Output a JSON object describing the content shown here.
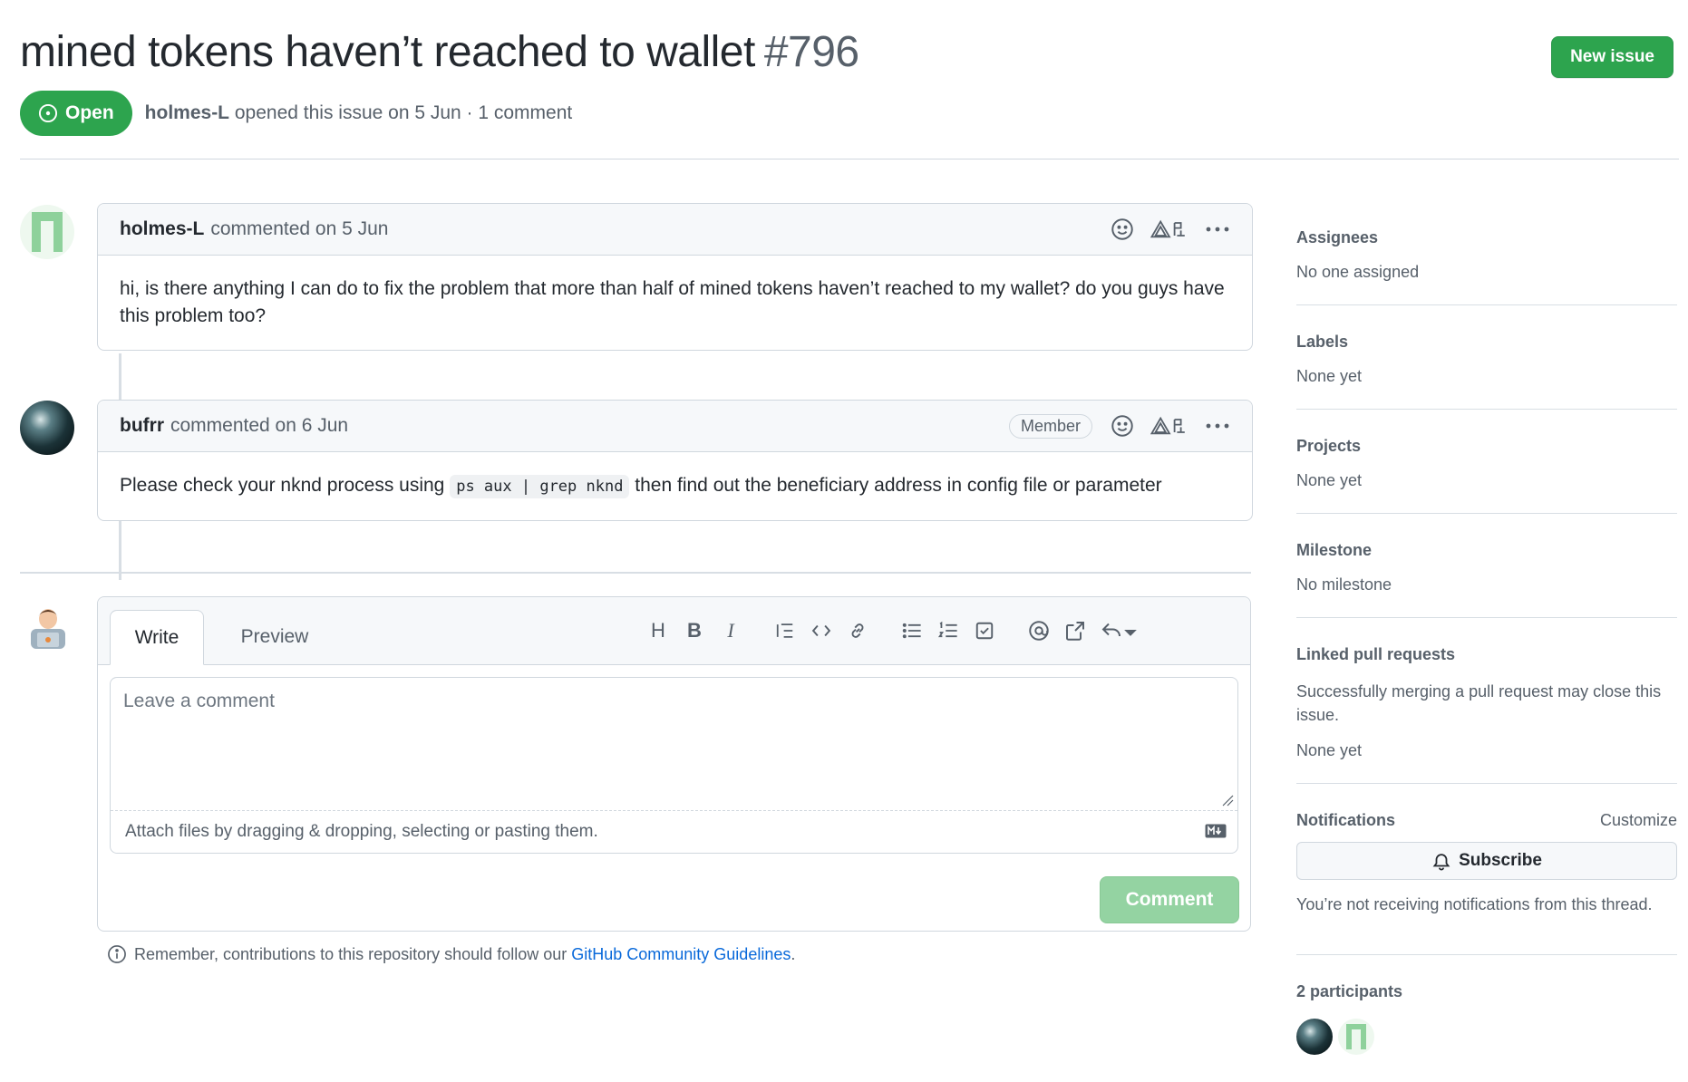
{
  "issue": {
    "title": "mined tokens haven’t reached to wallet",
    "number": "#796",
    "state": "Open",
    "author": "holmes-L",
    "opened_text": "opened this issue on 5 Jun · 1 comment"
  },
  "header": {
    "new_issue_label": "New issue"
  },
  "comments": [
    {
      "author": "holmes-L",
      "meta": "commented on 5 Jun",
      "body": "hi, is there anything I can do to fix the problem that more than half of mined tokens haven’t reached to my wallet? do you guys have this problem too?"
    },
    {
      "author": "bufrr",
      "meta": "commented on 6 Jun",
      "role_badge": "Member",
      "body_before": "Please check your nknd process using",
      "body_code": "ps aux | grep nknd",
      "body_after": "then find out the beneficiary address in config file or parameter"
    }
  ],
  "composer": {
    "tab_write": "Write",
    "tab_preview": "Preview",
    "placeholder": "Leave a comment",
    "attach_text": "Attach files by dragging & dropping, selecting or pasting them.",
    "submit_label": "Comment",
    "toolbar": {
      "heading_glyph": "H",
      "bold_glyph": "B",
      "italic_glyph": "I"
    }
  },
  "guidelines": {
    "prefix": "Remember, contributions to this repository should follow our",
    "link": "GitHub Community Guidelines",
    "suffix": "."
  },
  "sidebar": {
    "assignees": {
      "title": "Assignees",
      "value": "No one assigned"
    },
    "labels": {
      "title": "Labels",
      "value": "None yet"
    },
    "projects": {
      "title": "Projects",
      "value": "None yet"
    },
    "milestone": {
      "title": "Milestone",
      "value": "No milestone"
    },
    "linked_prs": {
      "title": "Linked pull requests",
      "note": "Successfully merging a pull request may close this issue.",
      "value": "None yet"
    },
    "notifications": {
      "title": "Notifications",
      "customize": "Customize",
      "subscribe_label": "Subscribe",
      "note": "You’re not receiving notifications from this thread."
    },
    "participants": {
      "title": "2 participants"
    }
  },
  "colors": {
    "accent_green": "#2da44e",
    "link_blue": "#0969da",
    "identicon_green": "#8ed19b"
  },
  "icons": [
    "issue-opened-icon",
    "smiley-icon",
    "copilot-icon",
    "kebab-horizontal-icon",
    "heading-icon",
    "bold-icon",
    "italic-icon",
    "quote-icon",
    "code-icon",
    "link-icon",
    "unordered-list-icon",
    "ordered-list-icon",
    "tasklist-icon",
    "mention-icon",
    "cross-reference-icon",
    "reply-icon",
    "markdown-icon",
    "info-icon",
    "bell-icon"
  ]
}
